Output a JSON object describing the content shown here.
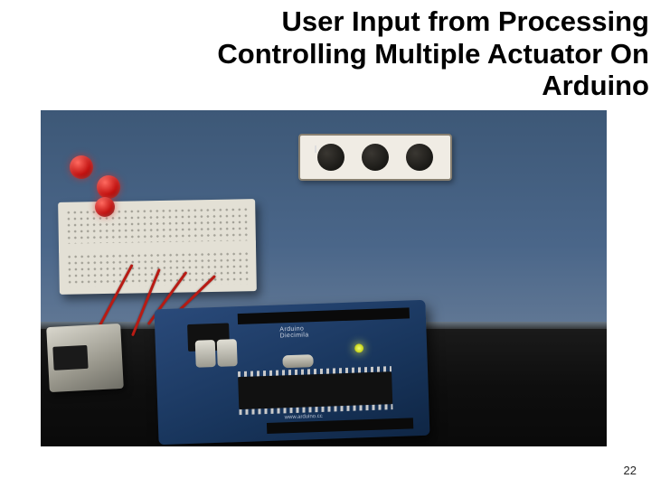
{
  "slide": {
    "title_line1": "User Input from Processing",
    "title_line2": "Controlling Multiple Actuator On",
    "title_line3": "Arduino",
    "page_number": "22"
  },
  "photo": {
    "panel": {
      "dots": 3
    },
    "breadboard": {
      "leds": 3,
      "led_color": "#c21210"
    },
    "arduino": {
      "label": "Arduino",
      "model": "Diecimila",
      "url": "www.arduino.cc",
      "power_led_on": true
    }
  }
}
